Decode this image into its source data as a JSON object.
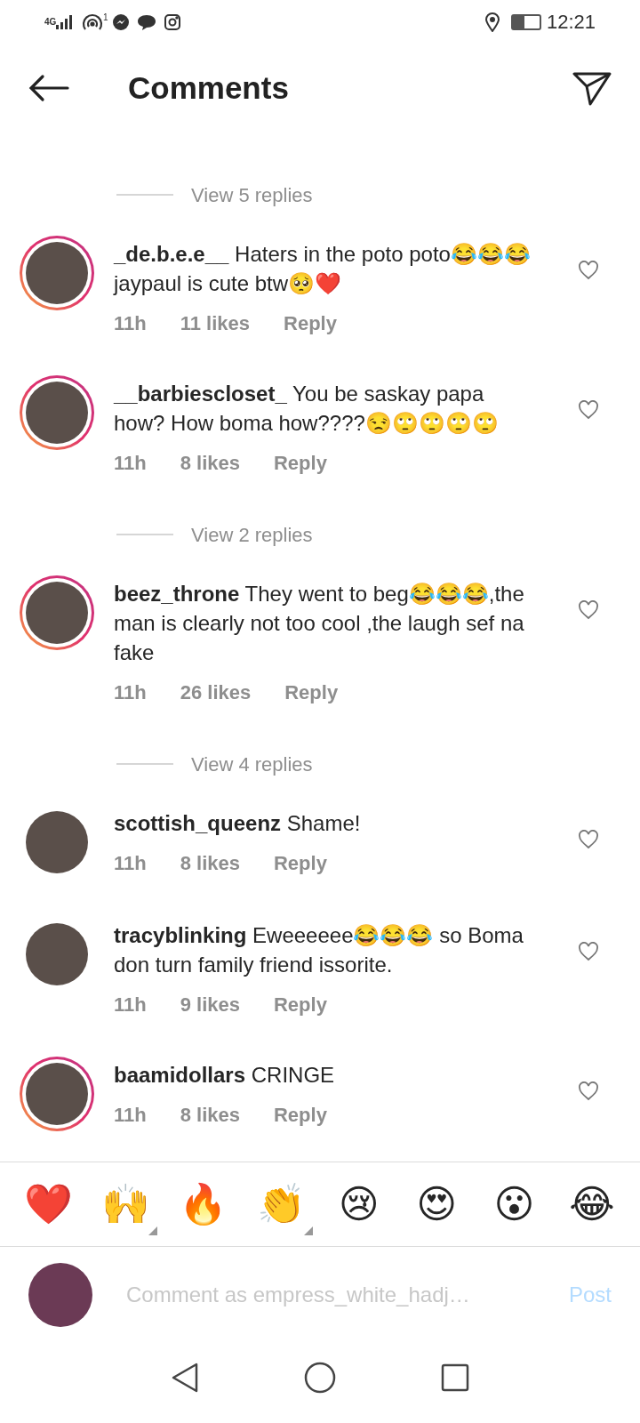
{
  "status_bar": {
    "network": "4G",
    "hotspot_count": "1",
    "time": "12:21",
    "battery": {
      "level": 0.45
    }
  },
  "header": {
    "title": "Comments"
  },
  "comments": [
    {
      "kind": "view_replies",
      "label": "View 5 replies"
    },
    {
      "kind": "comment",
      "user": "_de.b.e.e__",
      "text": "Haters in the poto poto😂😂😂 jaypaul is cute btw🥺❤️",
      "time": "11h",
      "likes": "11 likes",
      "reply": "Reply",
      "story_ring": true
    },
    {
      "kind": "comment",
      "user": "__barbiescloset_",
      "text": "You be saskay papa how? How boma how????😒🙄🙄🙄🙄",
      "time": "11h",
      "likes": "8 likes",
      "reply": "Reply",
      "story_ring": true
    },
    {
      "kind": "view_replies",
      "label": "View 2 replies"
    },
    {
      "kind": "comment",
      "user": "beez_throne",
      "text": "They went to beg😂😂😂,the man is clearly not too cool ,the laugh sef na fake",
      "time": "11h",
      "likes": "26 likes",
      "reply": "Reply",
      "story_ring": true
    },
    {
      "kind": "view_replies",
      "label": "View 4 replies"
    },
    {
      "kind": "comment",
      "user": "scottish_queenz",
      "text": "Shame!",
      "time": "11h",
      "likes": "8 likes",
      "reply": "Reply",
      "story_ring": false
    },
    {
      "kind": "comment",
      "user": "tracyblinking",
      "text": "Eweeeeee😂😂😂 so Boma don turn family friend issorite.",
      "time": "11h",
      "likes": "9 likes",
      "reply": "Reply",
      "story_ring": false
    },
    {
      "kind": "comment",
      "user": "baamidollars",
      "text": "CRINGE",
      "time": "11h",
      "likes": "8 likes",
      "reply": "Reply",
      "story_ring": true
    }
  ],
  "reactions": [
    {
      "emoji": "❤️",
      "has_variants": false
    },
    {
      "emoji": "🙌",
      "has_variants": true
    },
    {
      "emoji": "🔥",
      "has_variants": false
    },
    {
      "emoji": "👏",
      "has_variants": true
    },
    {
      "emoji": "😢",
      "has_variants": false
    },
    {
      "emoji": "😍",
      "has_variants": false
    },
    {
      "emoji": "😮",
      "has_variants": false
    },
    {
      "emoji": "😂",
      "has_variants": false
    }
  ],
  "composer": {
    "placeholder": "Comment as empress_white_hadj…",
    "post": "Post",
    "post_disabled": true
  }
}
